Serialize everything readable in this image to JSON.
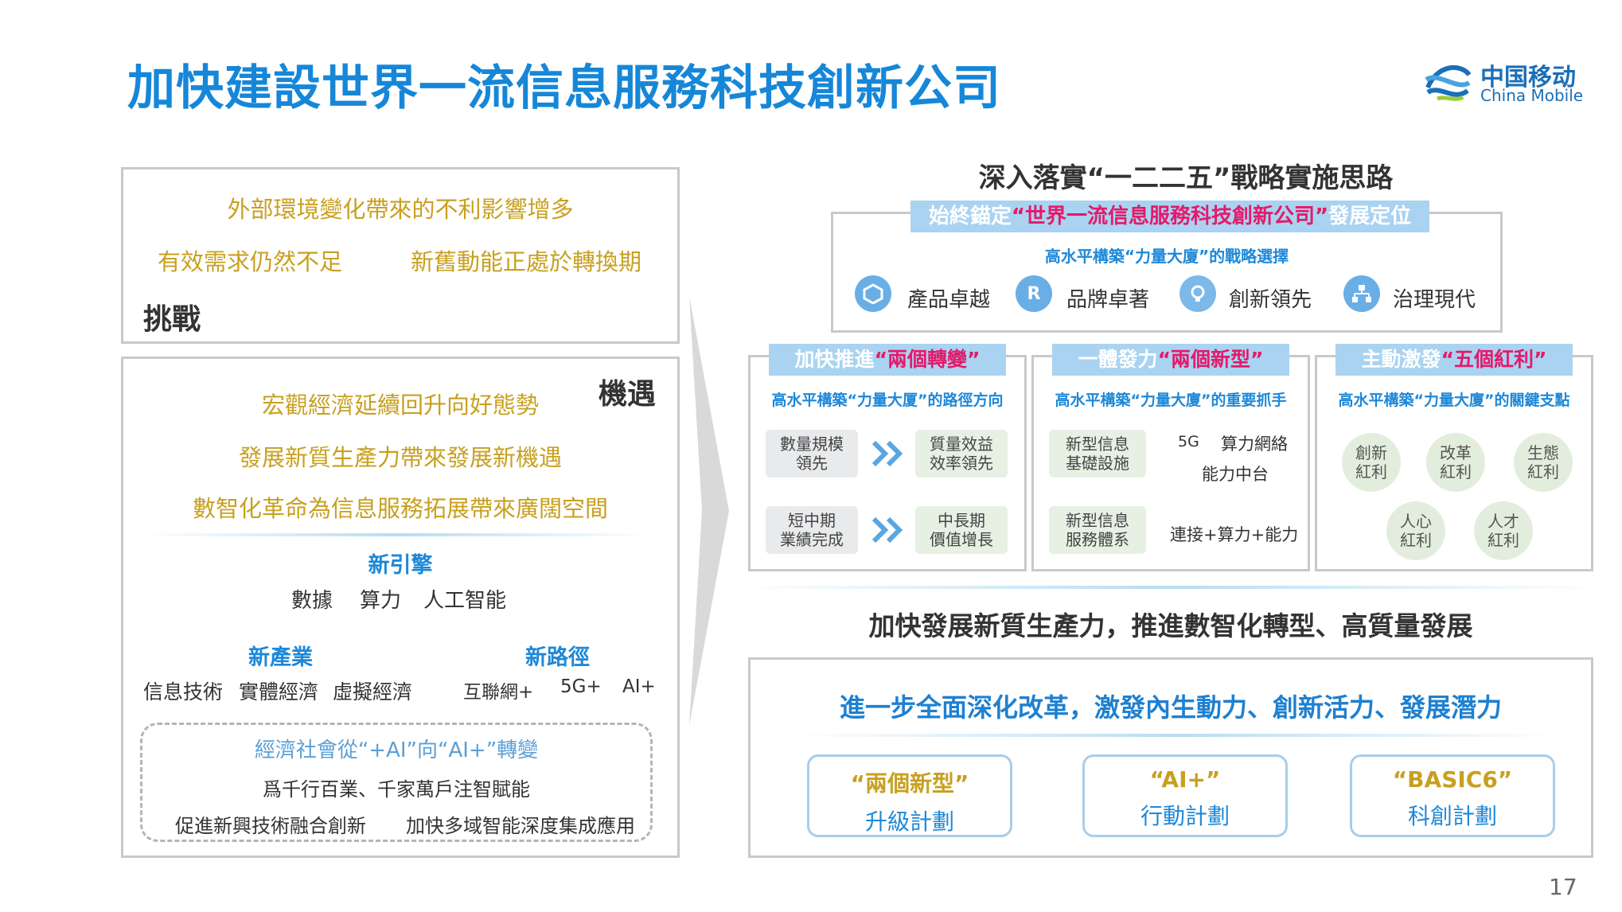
{
  "header": {
    "title": "加快建設世界一流信息服務科技創新公司",
    "logo_cn": "中国移动",
    "logo_en": "China Mobile"
  },
  "challenge": {
    "line1": "外部環境變化帶來的不利影響增多",
    "line2a": "有效需求仍然不足",
    "line2b": "新舊動能正處於轉換期",
    "label": "挑戰"
  },
  "opportunity": {
    "label": "機遇",
    "lines": [
      "宏觀經濟延續回升向好態勢",
      "發展新質生產力帶來發展新機遇",
      "數智化革命為信息服務拓展帶來廣闊空間"
    ],
    "engine_title": "新引擎",
    "engine_items": [
      "數據",
      "算力",
      "人工智能"
    ],
    "industry_title": "新產業",
    "industry_items": [
      "信息技術",
      "實體經濟",
      "虛擬經濟"
    ],
    "path_title": "新路徑",
    "path_items": [
      "互聯網+",
      "5G+",
      "AI+"
    ],
    "dashed_title": "經濟社會從“+AI”向“AI+”轉變",
    "dashed_line1": "爲千行百業、千家萬戶注智賦能",
    "dashed_line2a": "促進新興技術融合創新",
    "dashed_line2b": "加快多域智能深度集成應用"
  },
  "strategy": {
    "title": "深入落實“一二二五”戰略實施思路",
    "anchor_pre": "始終錨定",
    "anchor_mid": "“世界一流信息服務科技創新公司”",
    "anchor_post": "發展定位",
    "choice": "高水平構築“力量大廈”的戰略選擇",
    "pillars": [
      "產品卓越",
      "品牌卓著",
      "創新領先",
      "治理現代"
    ]
  },
  "col1": {
    "hdr_pre": "加快推進",
    "hdr_pink": "“兩個轉變”",
    "sub": "高水平構築“力量大厦”的路徑方向",
    "a1": "數量規模\n領先",
    "b1": "質量效益\n效率領先",
    "a2": "短中期\n業績完成",
    "b2": "中長期\n價值增長"
  },
  "col2": {
    "hdr_pre": "一體發力",
    "hdr_pink": "“兩個新型”",
    "sub": "高水平構築“力量大廈”的重要抓手",
    "a1": "新型信息\n基礎設施",
    "t1a": "5G",
    "t1b": "算力網絡",
    "t1c": "能力中台",
    "a2": "新型信息\n服務體系",
    "t2": "連接+算力+能力"
  },
  "col3": {
    "hdr_pre": "主動激發",
    "hdr_pink": "“五個紅利”",
    "sub": "高水平構築“力量大廈”的關鍵支點",
    "circles": [
      "創新\n紅利",
      "改革\n紅利",
      "生態\n紅利",
      "人心\n紅利",
      "人才\n紅利"
    ]
  },
  "bottom": {
    "title": "加快發展新質生產力，推進數智化轉型、高質量發展",
    "reform": "進一步全面深化改革，激發內生動力、創新活力、發展潛力",
    "plans": [
      {
        "t": "“兩個新型”",
        "s": "升級計劃"
      },
      {
        "t": "“AI+”",
        "s": "行動計劃"
      },
      {
        "t": "“BASIC6”",
        "s": "科創計劃"
      }
    ]
  },
  "page_number": "17",
  "colors": {
    "title_blue": "#1687d8",
    "gold": "#c8a020",
    "pink": "#e5196a",
    "bar_blue": "#a9d3f1"
  }
}
